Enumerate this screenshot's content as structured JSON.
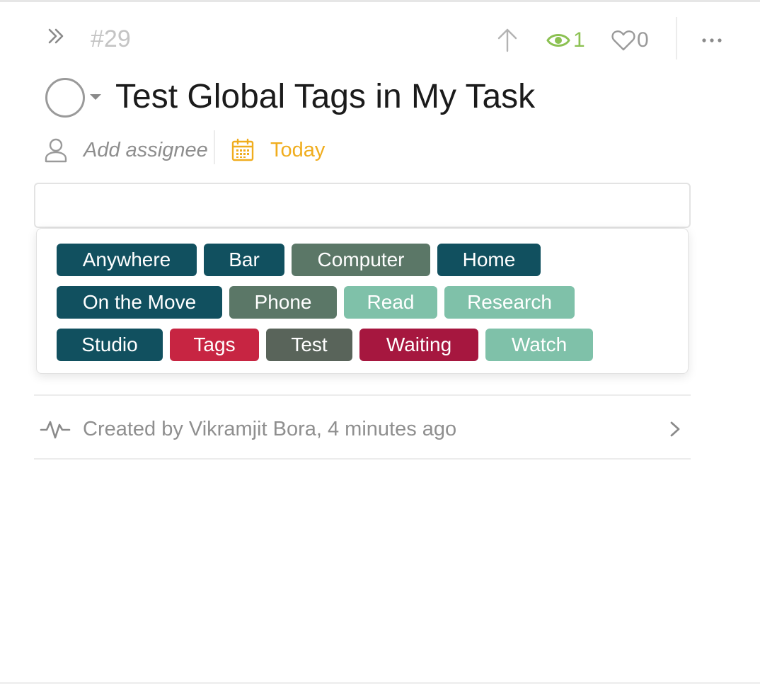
{
  "header": {
    "task_number": "#29",
    "watchers_count": "1",
    "likes_count": "0"
  },
  "task": {
    "title": "Test Global Tags in My Task"
  },
  "meta": {
    "assignee_placeholder": "Add assignee",
    "due_date": "Today"
  },
  "tag_input": {
    "value": ""
  },
  "tags": [
    {
      "label": "Anywhere",
      "color": "#11505f"
    },
    {
      "label": "Bar",
      "color": "#11505f"
    },
    {
      "label": "Computer",
      "color": "#5b7767"
    },
    {
      "label": "Home",
      "color": "#11505f"
    },
    {
      "label": "On the Move",
      "color": "#11505f"
    },
    {
      "label": "Phone",
      "color": "#5b7767"
    },
    {
      "label": "Read",
      "color": "#7fc1a9"
    },
    {
      "label": "Research",
      "color": "#7fc1a9"
    },
    {
      "label": "Studio",
      "color": "#11505f"
    },
    {
      "label": "Tags",
      "color": "#c72542"
    },
    {
      "label": "Test",
      "color": "#59645a"
    },
    {
      "label": "Waiting",
      "color": "#a6173f"
    },
    {
      "label": "Watch",
      "color": "#7fc1a9"
    }
  ],
  "activity": {
    "text": "Created by Vikramjit Bora, 4 minutes ago"
  },
  "icons": {
    "collapse": "double-chevron-right-icon",
    "priority": "arrow-up-icon",
    "watchers": "eye-icon",
    "likes": "heart-icon",
    "more": "ellipsis-icon",
    "assignee": "user-icon",
    "due_date": "calendar-icon",
    "activity": "pulse-icon",
    "expand": "chevron-right-icon"
  },
  "colors": {
    "watchers_accent": "#8cc152",
    "due_date_accent": "#f0ad1e"
  }
}
